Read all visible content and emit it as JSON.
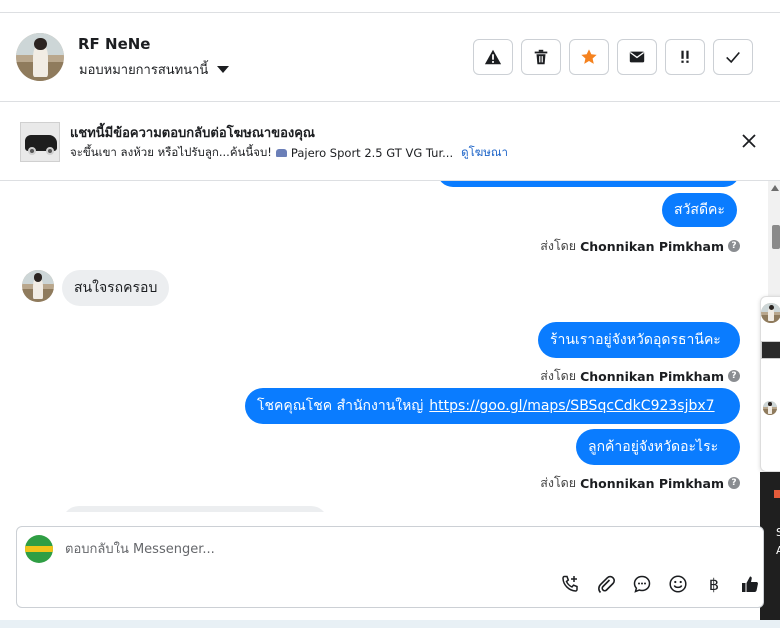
{
  "header": {
    "name": "RF NeNe",
    "assign_label": "มอบหมายการสนทนานี้"
  },
  "ad_banner": {
    "title": "แชทนี้มีข้อความตอบกลับต่อโฆษณาของคุณ",
    "subtitle": "จะขึ้นเขา ลงห้วย หรือไปรับลูก...ค้นนี้จบ!",
    "product": "Pajero Sport 2.5 GT VG Tur...",
    "link": "ดูโฆษณา"
  },
  "messages": {
    "m1": "สวัสดีคะ",
    "m2": "สนใจรถครอบ",
    "m3": "ร้านเราอยู่จังหวัดอุดรธานีคะ",
    "m4_text": "โชคคุณโชค สำนักงานใหญ่",
    "m4_link": "https://goo.gl/maps/SBSqcCdkC923sjbx7",
    "m5": "ลูกค้าอยู่จังหวัดอะไระ",
    "sent_prefix": "ส่งโดย",
    "sender": "Chonnikan Pimkham",
    "info": "?"
  },
  "side_panel": {
    "t1": "S",
    "t2": "A"
  },
  "composer": {
    "placeholder": "ตอบกลับใน Messenger...",
    "currency": "฿"
  },
  "colors": {
    "bubble_out": "#0a7cff",
    "bubble_in": "#eceef0",
    "link": "#1d64c8",
    "star": "#f5821f"
  }
}
